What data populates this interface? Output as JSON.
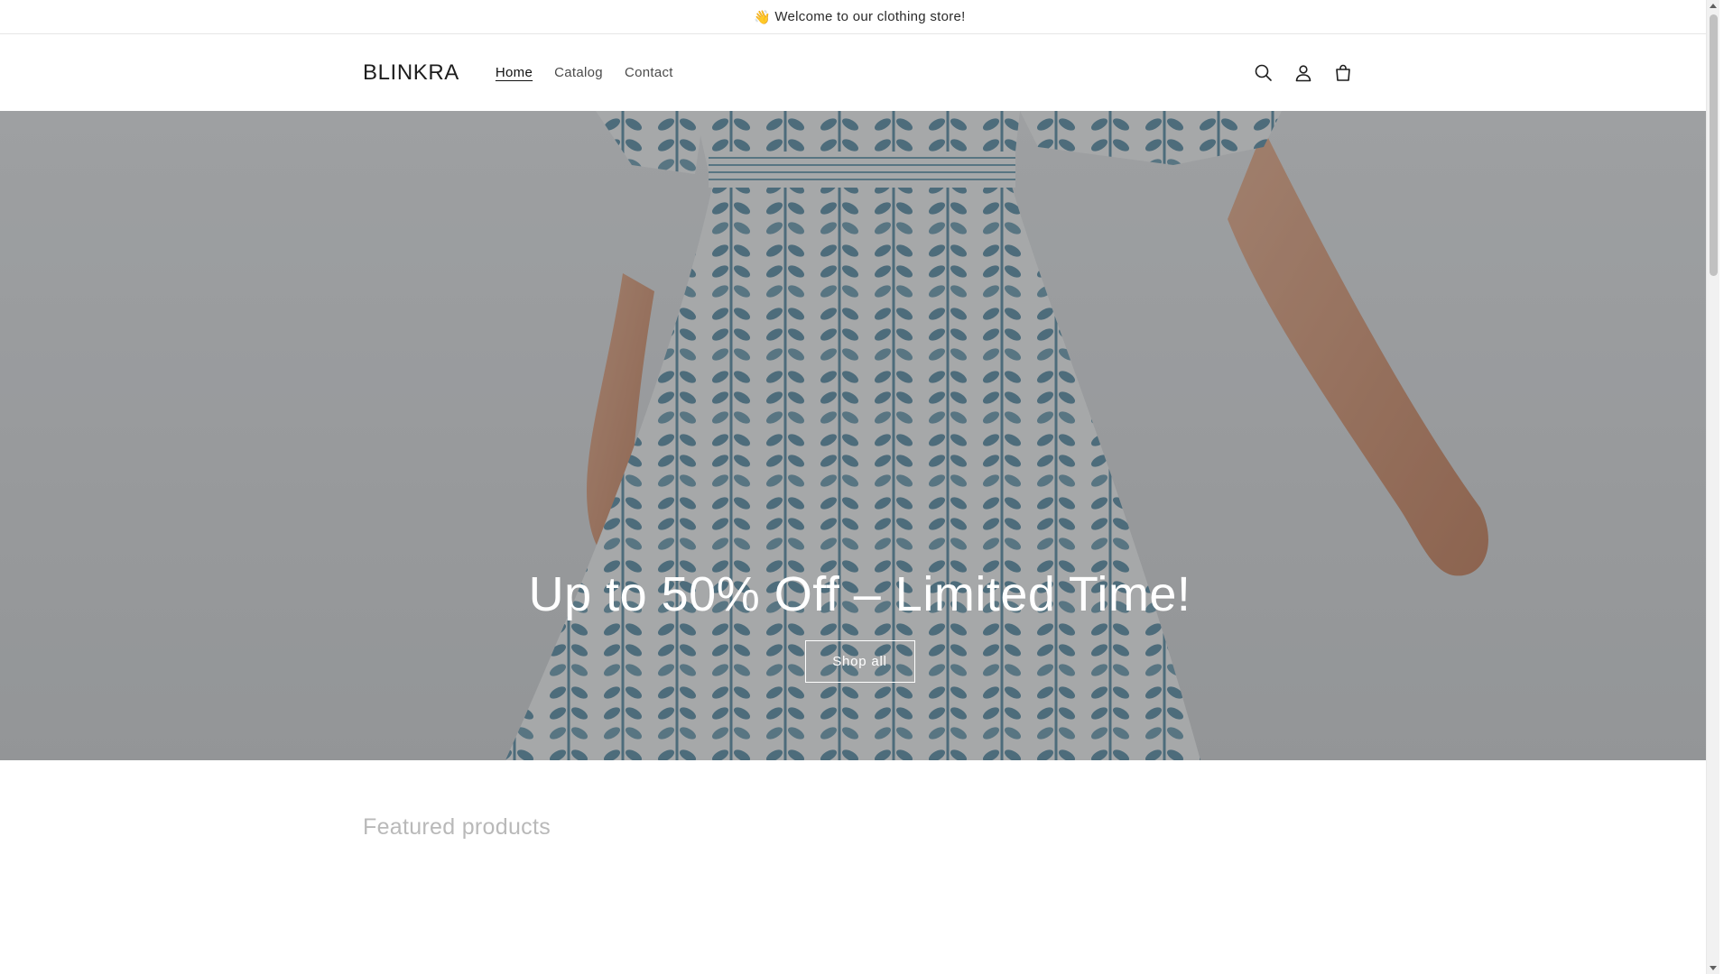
{
  "announcement": {
    "emoji": "👋",
    "text": "Welcome to our clothing store!"
  },
  "header": {
    "logo": "BLINKRA",
    "nav": [
      {
        "label": "Home",
        "active": true
      },
      {
        "label": "Catalog",
        "active": false
      },
      {
        "label": "Contact",
        "active": false
      }
    ],
    "icons": [
      "search-icon",
      "account-icon",
      "cart-icon"
    ]
  },
  "hero": {
    "title": "Up to 50% Off – Limited Time!",
    "button_label": "Shop all",
    "image": "woman-in-blue-patterned-dress"
  },
  "featured": {
    "title": "Featured products"
  },
  "colors": {
    "text": "#121212",
    "dress_blue": "#6f9bb0",
    "muted_heading": "#b9b9b9",
    "hero_overlay": "rgba(0,0,0,0.30)"
  }
}
